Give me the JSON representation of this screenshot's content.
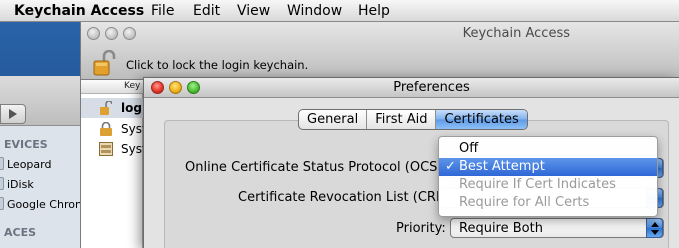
{
  "menubar": {
    "app_name": "Keychain Access",
    "items": [
      "File",
      "Edit",
      "View",
      "Window",
      "Help"
    ]
  },
  "finder": {
    "devices_header": "EVICES",
    "items": [
      "Leopard",
      "iDisk",
      "Google Chron"
    ],
    "places_header": "ACES"
  },
  "keychain_window": {
    "title": "Keychain Access",
    "lock_message": "Click to lock the login keychain.",
    "sidebar_header": "Key",
    "keychains": [
      "logi",
      "Syst",
      "Syst"
    ]
  },
  "preferences": {
    "title": "Preferences",
    "tabs": [
      "General",
      "First Aid",
      "Certificates"
    ],
    "active_tab": "Certificates",
    "ocsp_label": "Online Certificate Status Protocol (OCSP):",
    "crl_label": "Certificate Revocation List (CRL):",
    "priority_label": "Priority:",
    "priority_value": "Require Both"
  },
  "ocsp_menu": {
    "options": [
      {
        "label": "Off",
        "state": "normal"
      },
      {
        "label": "Best Attempt",
        "state": "selected",
        "checked": true
      },
      {
        "label": "Require If Cert Indicates",
        "state": "disabled"
      },
      {
        "label": "Require for All Certs",
        "state": "disabled"
      }
    ]
  },
  "colors": {
    "selection": "#3b74da",
    "desktop": "#1e4f8e"
  }
}
